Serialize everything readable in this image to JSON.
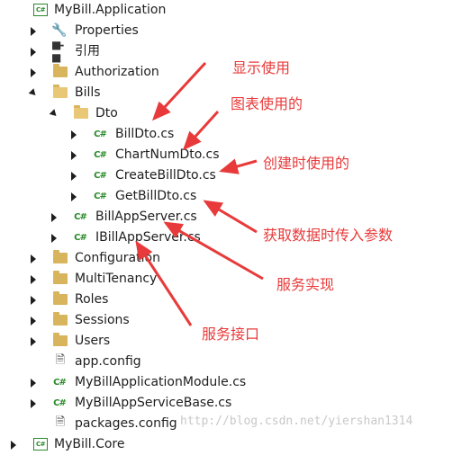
{
  "tree": {
    "root": {
      "label": "MyBill.Application",
      "icon": "csharp-project-icon"
    },
    "properties": {
      "label": "Properties",
      "icon": "wrench-icon"
    },
    "references": {
      "label": "引用",
      "icon": "references-icon"
    },
    "authorization": {
      "label": "Authorization",
      "icon": "folder-icon"
    },
    "bills": {
      "label": "Bills",
      "icon": "folder-open-icon"
    },
    "dto": {
      "label": "Dto",
      "icon": "folder-open-icon"
    },
    "billdto": {
      "label": "BillDto.cs",
      "icon": "csharp-file-icon"
    },
    "chartnumdto": {
      "label": "ChartNumDto.cs",
      "icon": "csharp-file-icon"
    },
    "createbilldto": {
      "label": "CreateBillDto.cs",
      "icon": "csharp-file-icon"
    },
    "getbilldto": {
      "label": "GetBillDto.cs",
      "icon": "csharp-file-icon"
    },
    "billappserver": {
      "label": "BillAppServer.cs",
      "icon": "csharp-file-icon"
    },
    "ibillappserver": {
      "label": "IBillAppServer.cs",
      "icon": "csharp-file-icon"
    },
    "configuration": {
      "label": "Configuration",
      "icon": "folder-icon"
    },
    "multitenancy": {
      "label": "MultiTenancy",
      "icon": "folder-icon"
    },
    "roles": {
      "label": "Roles",
      "icon": "folder-icon"
    },
    "sessions": {
      "label": "Sessions",
      "icon": "folder-icon"
    },
    "users": {
      "label": "Users",
      "icon": "folder-icon"
    },
    "appconfig": {
      "label": "app.config",
      "icon": "config-file-icon"
    },
    "module": {
      "label": "MyBillApplicationModule.cs",
      "icon": "csharp-file-icon"
    },
    "servicebase": {
      "label": "MyBillAppServiceBase.cs",
      "icon": "csharp-file-icon"
    },
    "packagesconfig": {
      "label": "packages.config",
      "icon": "config-file-icon"
    },
    "next": {
      "label": "MyBill.Core",
      "icon": "csharp-project-icon"
    }
  },
  "annotations": {
    "display": "显示使用",
    "chart": "图表使用的",
    "create": "创建时使用的",
    "get": "获取数据时传入参数",
    "impl": "服务实现",
    "iface": "服务接口"
  },
  "watermark": "http://blog.csdn.net/yiershan1314",
  "colors": {
    "annotation": "#e83a3a",
    "csharp": "#2a8a2a",
    "folder": "#d8b45c"
  }
}
